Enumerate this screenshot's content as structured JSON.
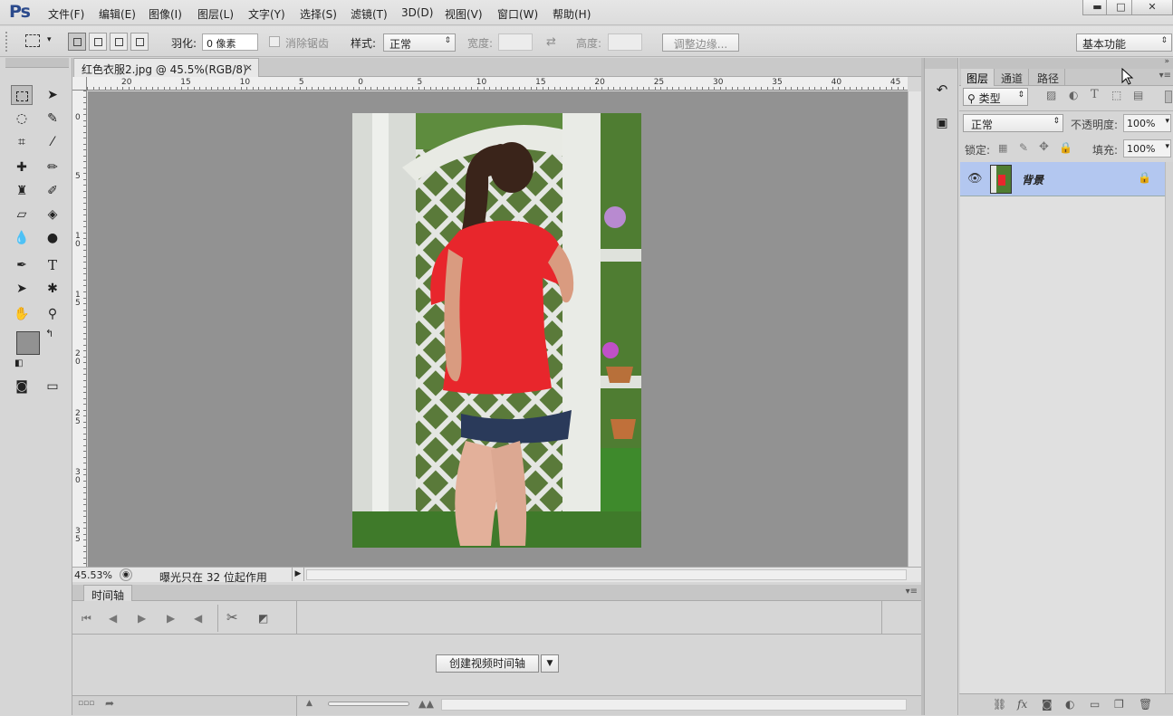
{
  "menubar": {
    "logo": "Ps",
    "items": [
      "文件(F)",
      "编辑(E)",
      "图像(I)",
      "图层(L)",
      "文字(Y)",
      "选择(S)",
      "滤镜(T)",
      "3D(D)",
      "视图(V)",
      "窗口(W)",
      "帮助(H)"
    ],
    "window_buttons": {
      "minimize": "▬",
      "maximize": "□",
      "close": "✕"
    }
  },
  "options": {
    "feather_label": "羽化:",
    "feather_value": "0 像素",
    "antialias_label": "消除锯齿",
    "style_label": "样式:",
    "style_value": "正常",
    "width_label": "宽度:",
    "height_label": "高度:",
    "refine_edge": "调整边缘...",
    "workspace": "基本功能"
  },
  "document": {
    "tab_title": "红色衣服2.jpg @ 45.5%(RGB/8)",
    "close_glyph": "×",
    "ruler_top_labels": [
      "20",
      "15",
      "10",
      "5",
      "0",
      "5",
      "10",
      "15",
      "20",
      "25",
      "30",
      "35",
      "40",
      "45"
    ],
    "ruler_left_labels": [
      "0",
      "5",
      "1\n0",
      "1\n5",
      "2\n0",
      "2\n5",
      "3\n0",
      "3\n5"
    ],
    "zoom": "45.53%",
    "status_text": "曝光只在 32 位起作用"
  },
  "timeline": {
    "tab_label": "时间轴",
    "create_button": "创建视频时间轴"
  },
  "layers": {
    "tabs": [
      "图层",
      "通道",
      "路径"
    ],
    "filter_label": "类型",
    "blend_mode": "正常",
    "opacity_label": "不透明度:",
    "opacity_value": "100%",
    "lock_label": "锁定:",
    "fill_label": "填充:",
    "fill_value": "100%",
    "layer_name": "背景"
  },
  "colors": {
    "layer_selected": "#b3c7f0",
    "canvas_bg": "#929292",
    "shirt_red": "#e8262c"
  }
}
